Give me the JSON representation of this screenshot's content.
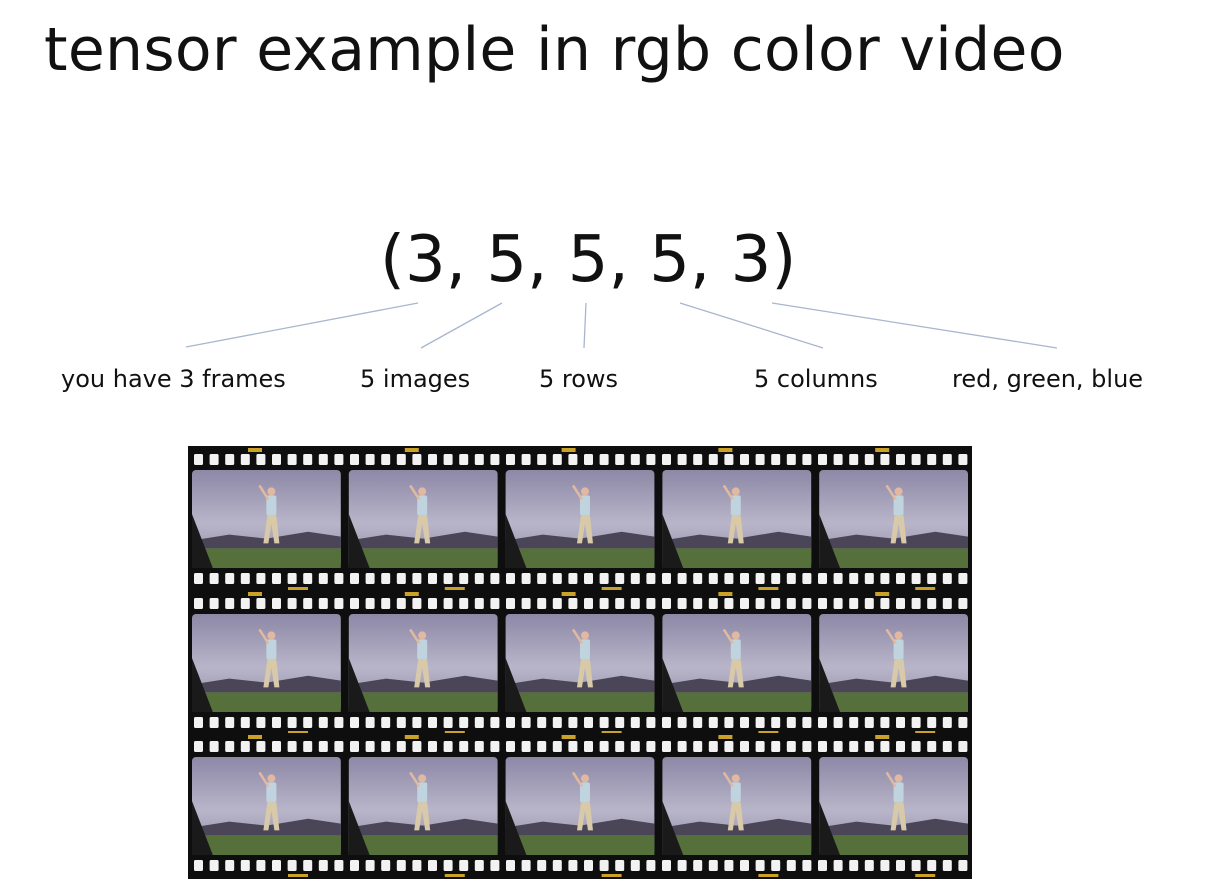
{
  "title": "tensor example in rgb color video",
  "tuple": {
    "text": "(3, 5, 5, 5, 3)",
    "values": [
      3,
      5,
      5,
      5,
      3
    ]
  },
  "labels": {
    "frames": "you have 3 frames",
    "images": "5 images",
    "rows": "5 rows",
    "columns": "5 columns",
    "channels": "red, green, blue"
  },
  "filmstrip": {
    "strips": 3,
    "frames_per_strip": 5,
    "colors": {
      "film": "#0e0e0e",
      "sky": "#8c88a6",
      "sky_light": "#b9b5c9",
      "mountains": "#4a4658",
      "grass": "#55703a",
      "golfer_shirt": "#bfd4df",
      "golfer_pants": "#d8c9a8",
      "edge_print": "#c9a227"
    }
  },
  "connector_color": "#a9b6cf"
}
